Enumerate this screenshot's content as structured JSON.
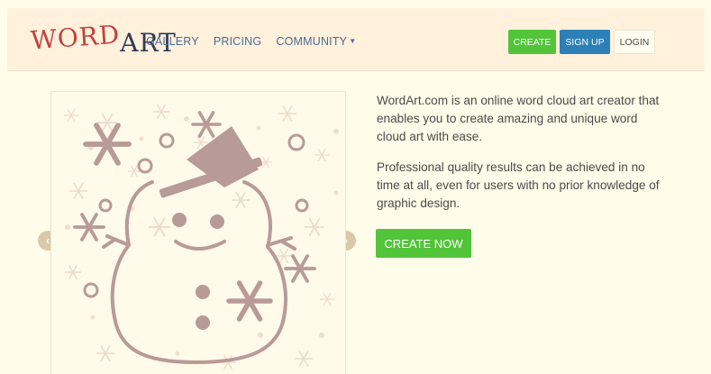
{
  "nav": {
    "logo_part1": "WORD",
    "logo_part2": "ART",
    "links": [
      "GALLERY",
      "PRICING",
      "COMMUNITY"
    ],
    "buttons": {
      "create": "CREATE",
      "signup": "SIGN UP",
      "login": "LOGIN"
    }
  },
  "hero": {
    "paragraph1": "WordArt.com is an online word cloud art creator that enables you to create amazing and unique word cloud art with ease.",
    "paragraph2": "Professional quality results can be achieved in no time at all, even for users with no prior knowledge of graphic design.",
    "cta_label": "CREATE NOW"
  },
  "carousel": {
    "prev_icon": "chevron-left-icon",
    "next_icon": "chevron-right-icon"
  },
  "colors": {
    "page_bg": "#fffde9",
    "navbar_bg": "#fff1dc",
    "green": "#52c43a",
    "blue": "#2d7fb8",
    "snowman": "#b89a97",
    "snowflake": "#e9d7c4"
  }
}
